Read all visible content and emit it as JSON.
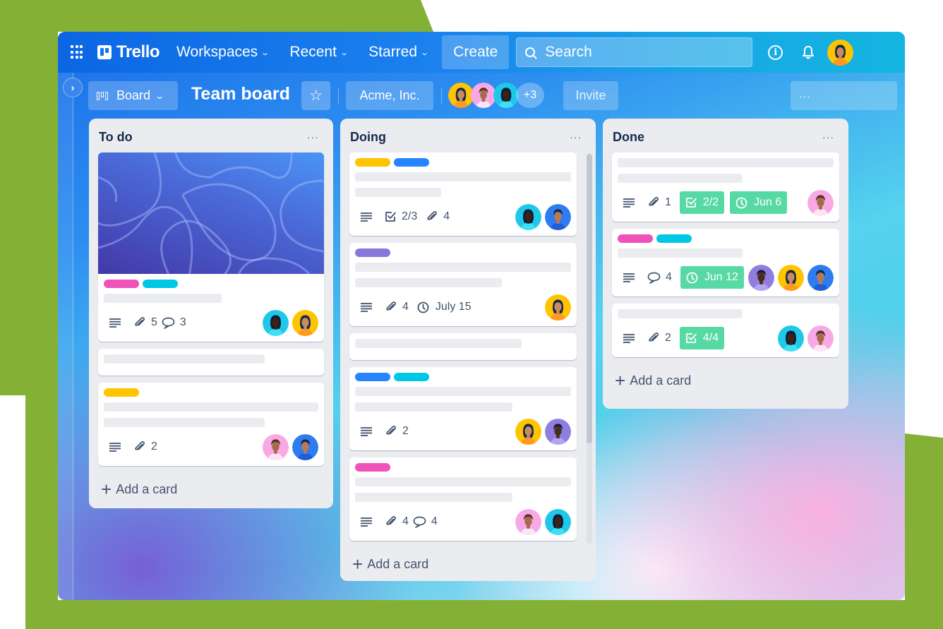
{
  "colors": {
    "brand_green": "#84b135",
    "nav_blue": "#0c66e4",
    "label_pink": "#ef52b8",
    "label_cyan": "#00c7e5",
    "label_yellow": "#ffc400",
    "label_blue": "#2684ff",
    "label_purple": "#8777d9",
    "badge_green": "#57d9a3"
  },
  "topnav": {
    "apps_icon": "grid-icon",
    "logo_text": "Trello",
    "menus": [
      {
        "label": "Workspaces",
        "icon": "chevron-down-icon"
      },
      {
        "label": "Recent",
        "icon": "chevron-down-icon"
      },
      {
        "label": "Starred",
        "icon": "chevron-down-icon"
      }
    ],
    "create_label": "Create",
    "search_placeholder": "Search",
    "info_icon": "info-icon",
    "bell_icon": "bell-icon",
    "avatar": "user-avatar-yellow"
  },
  "boardbar": {
    "expand_icon": "chevron-right-icon",
    "view_label": "Board",
    "board_title": "Team board",
    "star_icon": "star-icon",
    "workspace_label": "Acme, Inc.",
    "members": [
      "yellow",
      "pink",
      "cyan"
    ],
    "more_members": "+3",
    "invite_label": "Invite",
    "menu_label": "···"
  },
  "lists": [
    {
      "title": "To do",
      "menu": "···",
      "add_card": "Add a card",
      "cards": [
        {
          "cover": true,
          "labels": [
            "pink",
            "cyan"
          ],
          "lines": [
            0.55
          ],
          "description": true,
          "attachments": "5",
          "comments": "3",
          "members": [
            "cyan",
            "yellow"
          ]
        },
        {
          "labels": [],
          "lines": [
            0.75
          ],
          "description": false,
          "members": []
        },
        {
          "labels": [
            "yellow"
          ],
          "lines": [
            1.0,
            0.75
          ],
          "description": true,
          "attachments": "2",
          "members": [
            "pink",
            "blue"
          ]
        }
      ]
    },
    {
      "title": "Doing",
      "menu": "···",
      "add_card": "Add a card",
      "cards": [
        {
          "labels": [
            "yellow",
            "blue"
          ],
          "lines": [
            1.0,
            0.4
          ],
          "description": true,
          "checklist": "2/3",
          "attachments": "4",
          "members": [
            "cyan",
            "blue"
          ]
        },
        {
          "labels": [
            "purple"
          ],
          "lines": [
            1.0,
            0.68
          ],
          "description": true,
          "attachments": "4",
          "due": "July 15",
          "members": [
            "yellow"
          ]
        },
        {
          "labels": [],
          "lines": [
            0.77
          ],
          "description": false,
          "members": []
        },
        {
          "labels": [
            "blue",
            "cyan"
          ],
          "lines": [
            1.0,
            0.73
          ],
          "description": true,
          "attachments": "2",
          "members": [
            "yellow",
            "purple"
          ]
        },
        {
          "labels": [
            "pink"
          ],
          "lines": [
            1.0,
            0.73
          ],
          "description": true,
          "attachments": "4",
          "comments": "4",
          "members": [
            "pink",
            "cyan"
          ]
        }
      ]
    },
    {
      "title": "Done",
      "menu": "···",
      "add_card": "Add a card",
      "cards": [
        {
          "labels": [],
          "lines": [
            1.0,
            0.58
          ],
          "description": true,
          "attachments": "1",
          "checklist_done": "2/2",
          "due_done": "Jun 6",
          "members": [
            "pink"
          ]
        },
        {
          "labels": [
            "pink",
            "cyan"
          ],
          "lines": [
            0.58
          ],
          "description": true,
          "comments": "4",
          "due_done": "Jun 12",
          "members": [
            "purple",
            "yellow",
            "blue"
          ]
        },
        {
          "labels": [],
          "lines": [
            0.58
          ],
          "description": true,
          "attachments": "2",
          "checklist_done": "4/4",
          "members": [
            "cyan",
            "pink"
          ]
        }
      ]
    }
  ]
}
